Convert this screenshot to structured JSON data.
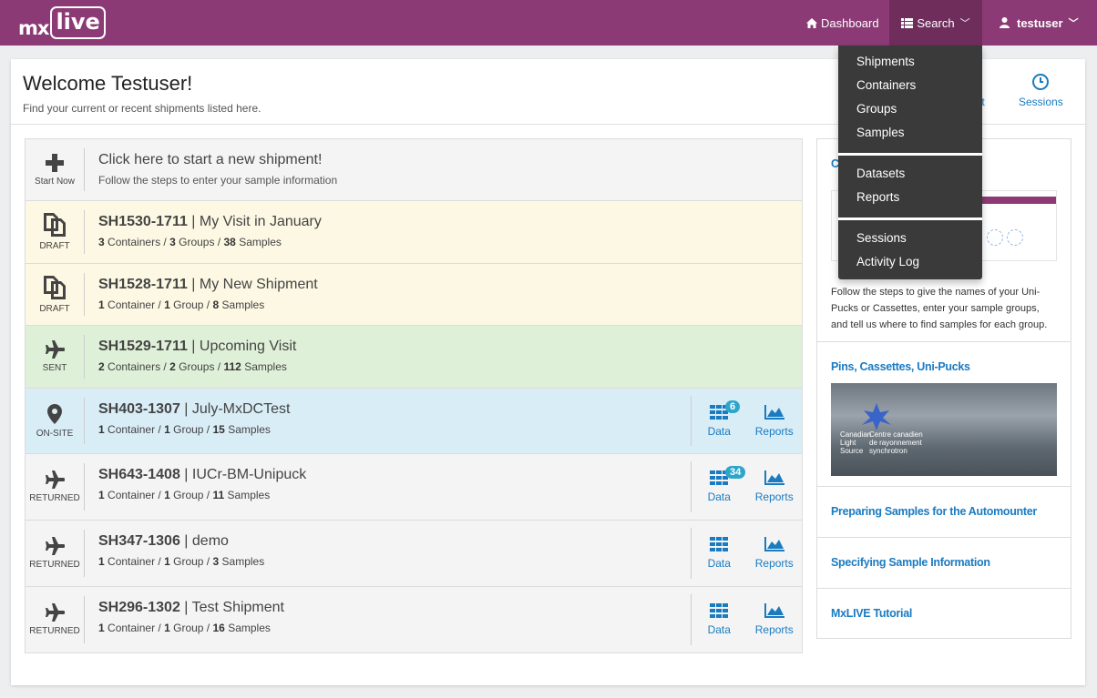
{
  "navbar": {
    "logo_prefix": "mx",
    "logo_word": "live",
    "dashboard_label": "Dashboard",
    "search_label": "Search",
    "user_label": "testuser",
    "brand_color": "#8b3a75"
  },
  "dropdown": {
    "items": [
      "Shipments",
      "Containers",
      "Groups",
      "Samples",
      "Datasets",
      "Reports",
      "Sessions",
      "Activity Log"
    ]
  },
  "header": {
    "title": "Welcome Testuser!",
    "subtitle": "Find your current or recent shipments listed here.",
    "shipment_link_partial": "ent",
    "sessions_label": "Sessions"
  },
  "start": {
    "status_label": "Start Now",
    "title": "Click here to start a new shipment!",
    "subtitle": "Follow the steps to enter your sample information"
  },
  "shipments": [
    {
      "status": "DRAFT",
      "code": "SH1530-1711",
      "name": "My Visit in January",
      "containers": "3",
      "containers_label": "Containers",
      "groups": "3",
      "groups_label": "Groups",
      "samples": "38",
      "samples_label": "Samples"
    },
    {
      "status": "DRAFT",
      "code": "SH1528-1711",
      "name": "My New Shipment",
      "containers": "1",
      "containers_label": "Container",
      "groups": "1",
      "groups_label": "Group",
      "samples": "8",
      "samples_label": "Samples"
    },
    {
      "status": "SENT",
      "code": "SH1529-1711",
      "name": "Upcoming Visit",
      "containers": "2",
      "containers_label": "Containers",
      "groups": "2",
      "groups_label": "Groups",
      "samples": "112",
      "samples_label": "Samples"
    },
    {
      "status": "ON-SITE",
      "code": "SH403-1307",
      "name": "July-MxDCTest",
      "containers": "1",
      "containers_label": "Container",
      "groups": "1",
      "groups_label": "Group",
      "samples": "15",
      "samples_label": "Samples",
      "data_badge": "6",
      "data_label": "Data",
      "reports_label": "Reports"
    },
    {
      "status": "RETURNED",
      "code": "SH643-1408",
      "name": "IUCr-BM-Unipuck",
      "containers": "1",
      "containers_label": "Container",
      "groups": "1",
      "groups_label": "Group",
      "samples": "11",
      "samples_label": "Samples",
      "data_badge": "34",
      "data_label": "Data",
      "reports_label": "Reports"
    },
    {
      "status": "RETURNED",
      "code": "SH347-1306",
      "name": "demo",
      "containers": "1",
      "containers_label": "Container",
      "groups": "1",
      "groups_label": "Group",
      "samples": "3",
      "samples_label": "Samples",
      "data_label": "Data",
      "reports_label": "Reports"
    },
    {
      "status": "RETURNED",
      "code": "SH296-1302",
      "name": "Test Shipment",
      "containers": "1",
      "containers_label": "Container",
      "groups": "1",
      "groups_label": "Group",
      "samples": "16",
      "samples_label": "Samples",
      "data_label": "Data",
      "reports_label": "Reports"
    }
  ],
  "sidebar": {
    "first_title_partial": "C",
    "first_text": "Follow the steps to give the names of your Uni-Pucks or Cassettes, enter your sample groups, and tell us where to find samples for each group.",
    "pins_title": "Pins, Cassettes, Uni-Pucks",
    "pins_logo_line1": "Canadian",
    "pins_logo_line2": "Light",
    "pins_logo_line3": "Source",
    "pins_logo_fr1": "Centre canadien",
    "pins_logo_fr2": "de rayonnement",
    "pins_logo_fr3": "synchrotron",
    "automounter_title": "Preparing Samples for the Automounter",
    "sample_info_title": "Specifying Sample Information",
    "tutorial_title": "MxLIVE Tutorial"
  }
}
